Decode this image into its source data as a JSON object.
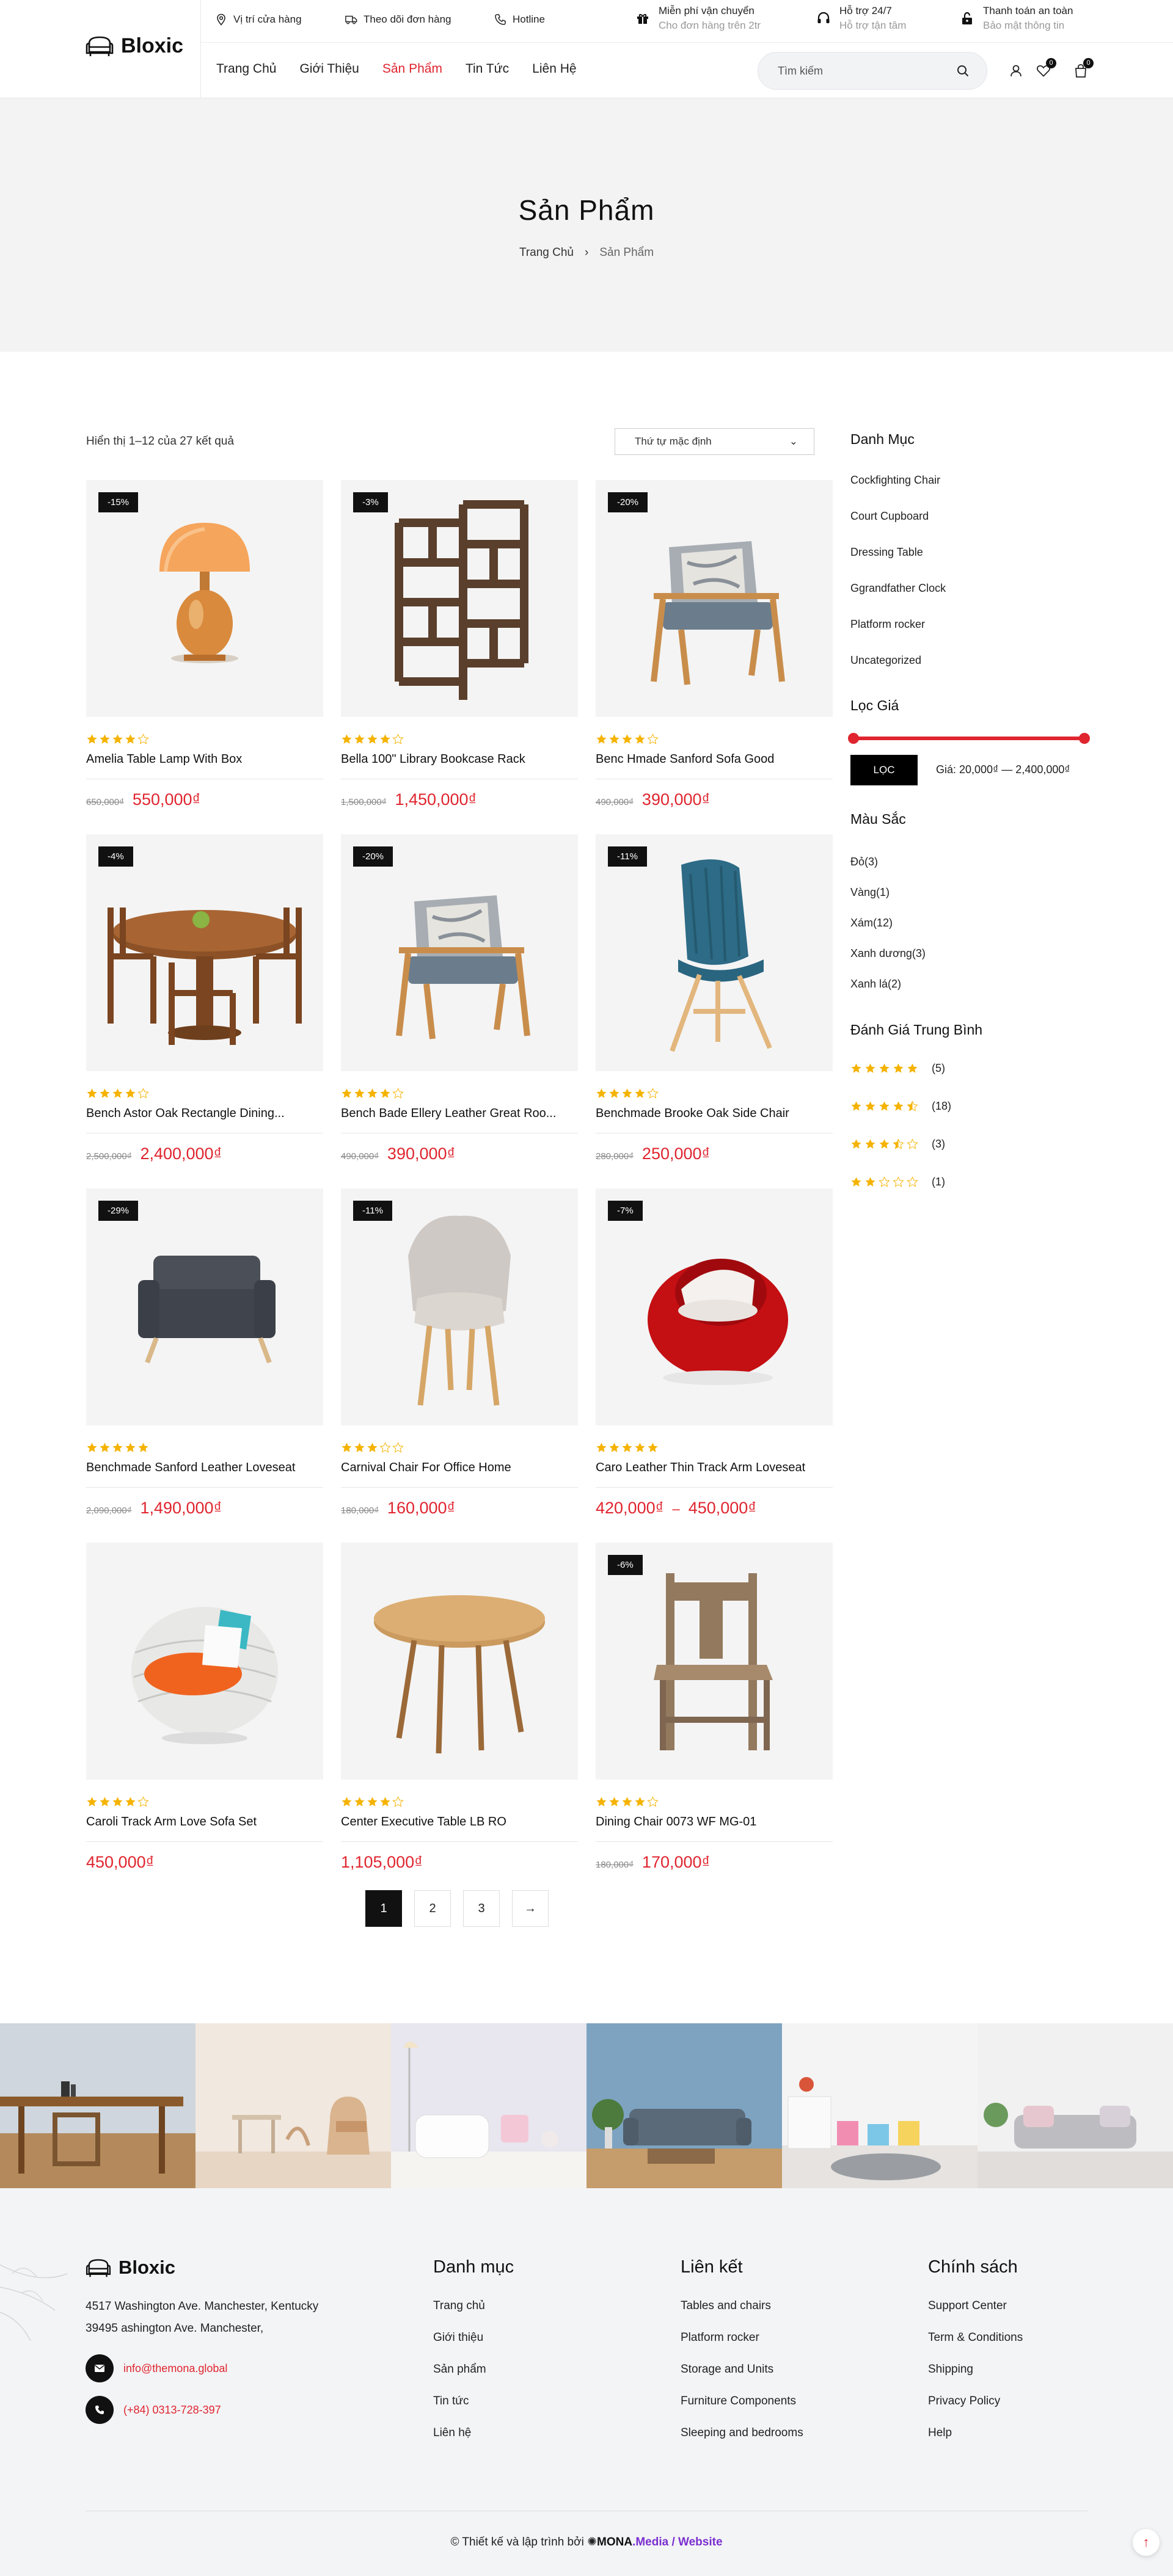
{
  "brand": {
    "name": "Bloxic"
  },
  "topbar": {
    "store_location": "Vị trí cửa hàng",
    "track_order": "Theo dõi đơn hàng",
    "hotline": "Hotline",
    "info": [
      {
        "title": "Miễn phí vận chuyển",
        "subtitle": "Cho đơn hàng trên 2tr",
        "icon": "gift-icon"
      },
      {
        "title": "Hỗ trợ 24/7",
        "subtitle": "Hỗ trợ tận tâm",
        "icon": "headset-icon"
      },
      {
        "title": "Thanh toán an toàn",
        "subtitle": "Bảo mật thông tin",
        "icon": "lock-icon"
      }
    ]
  },
  "nav": {
    "items": [
      "Trang Chủ",
      "Giới Thiệu",
      "Sản Phẩm",
      "Tin Tức",
      "Liên Hệ"
    ],
    "active_index": 2
  },
  "search": {
    "placeholder": "Tìm kiếm"
  },
  "header_icons": {
    "wishlist_count": "0",
    "cart_count": "0"
  },
  "page": {
    "title": "Sản Phẩm",
    "breadcrumb": [
      "Trang Chủ",
      "Sản Phẩm"
    ]
  },
  "shop": {
    "result_text": "Hiển thị 1–12 của 27 kết quả",
    "sort_selected": "Thứ tự mặc định",
    "accent": "#e0252f",
    "star_color": "#f5b301"
  },
  "products": [
    {
      "name": "Amelia Table Lamp With Box",
      "sale": "-15%",
      "old_price": "650,000₫",
      "price": "550,000₫",
      "rating": 4,
      "image": "lamp"
    },
    {
      "name": "Bella 100\" Library Bookcase Rack",
      "sale": "-3%",
      "old_price": "1,500,000₫",
      "price": "1,450,000₫",
      "rating": 4,
      "image": "bookcase"
    },
    {
      "name": "Benc Hmade Sanford Sofa Good",
      "sale": "-20%",
      "old_price": "490,000₫",
      "price": "390,000₫",
      "rating": 4,
      "image": "armchair"
    },
    {
      "name": "Bench Astor Oak Rectangle Dining...",
      "sale": "-4%",
      "old_price": "2,500,000₫",
      "price": "2,400,000₫",
      "rating": 4,
      "image": "dining"
    },
    {
      "name": "Bench Bade Ellery Leather Great Roo...",
      "sale": "-20%",
      "old_price": "490,000₫",
      "price": "390,000₫",
      "rating": 4,
      "image": "armchair"
    },
    {
      "name": "Benchmade Brooke Oak Side Chair",
      "sale": "-11%",
      "old_price": "280,000₫",
      "price": "250,000₫",
      "rating": 4,
      "image": "tealchair"
    },
    {
      "name": "Benchmade Sanford Leather Loveseat",
      "sale": "-29%",
      "old_price": "2,090,000₫",
      "price": "1,490,000₫",
      "rating": 5,
      "image": "greysofa"
    },
    {
      "name": "Carnival Chair For Office Home",
      "sale": "-11%",
      "old_price": "180,000₫",
      "price": "160,000₫",
      "rating": 3,
      "image": "whitechair"
    },
    {
      "name": "Caro Leather Thin Track Arm Loveseat",
      "sale": "-7%",
      "old_price": "",
      "price": "420,000₫",
      "price_max": "450,000₫",
      "rating": 5,
      "image": "redchair"
    },
    {
      "name": "Caroli Track Arm Love Sofa Set",
      "sale": "",
      "old_price": "",
      "price": "450,000₫",
      "rating": 4,
      "image": "wicker"
    },
    {
      "name": "Center Executive Table LB RO",
      "sale": "",
      "old_price": "",
      "price": "1,105,000₫",
      "rating": 4,
      "image": "roundtable"
    },
    {
      "name": "Dining Chair 0073 WF MG-01",
      "sale": "-6%",
      "old_price": "180,000₫",
      "price": "170,000₫",
      "rating": 4,
      "image": "woodchair"
    }
  ],
  "pagination": {
    "pages": [
      "1",
      "2",
      "3"
    ],
    "next": "→",
    "current": "1"
  },
  "sidebar": {
    "category_title": "Danh Mục",
    "categories": [
      "Cockfighting Chair",
      "Court Cupboard",
      "Dressing Table",
      "Ggrandfather Clock",
      "Platform rocker",
      "Uncategorized"
    ],
    "price_title": "Lọc Giá",
    "filter_button": "LỌC",
    "price_range": "Giá: 20,000₫ — 2,400,000₫",
    "color_title": "Màu Sắc",
    "colors": [
      "Đỏ(3)",
      "Vàng(1)",
      "Xám(12)",
      "Xanh dương(3)",
      "Xanh lá(2)"
    ],
    "rating_title": "Đánh Giá Trung Bình",
    "ratings": [
      {
        "stars": 5,
        "count": "(5)"
      },
      {
        "stars": 4.5,
        "count": "(18)"
      },
      {
        "stars": 3.5,
        "count": "(3)"
      },
      {
        "stars": 2,
        "count": "(1)"
      }
    ]
  },
  "footer": {
    "address_line1": "4517 Washington Ave. Manchester, Kentucky",
    "address_line2": "39495 ashington Ave. Manchester,",
    "email": "info@themona.global",
    "phone": "(+84) 0313-728-397",
    "columns": [
      {
        "title": "Danh mục",
        "links": [
          "Trang chủ",
          "Giới thiệu",
          "Sản phẩm",
          "Tin tức",
          "Liên hệ"
        ]
      },
      {
        "title": "Liên kết",
        "links": [
          "Tables and chairs",
          "Platform rocker",
          "Storage and Units",
          "Furniture Components",
          "Sleeping and bedrooms"
        ]
      },
      {
        "title": "Chính sách",
        "links": [
          "Support Center",
          "Term & Conditions",
          "Shipping",
          "Privacy Policy",
          "Help"
        ]
      }
    ],
    "copyright_prefix": "© Thiết kế và lập trình bởi",
    "copyright_brand1": "MONA",
    "copyright_brand2": ".Media / Website"
  }
}
